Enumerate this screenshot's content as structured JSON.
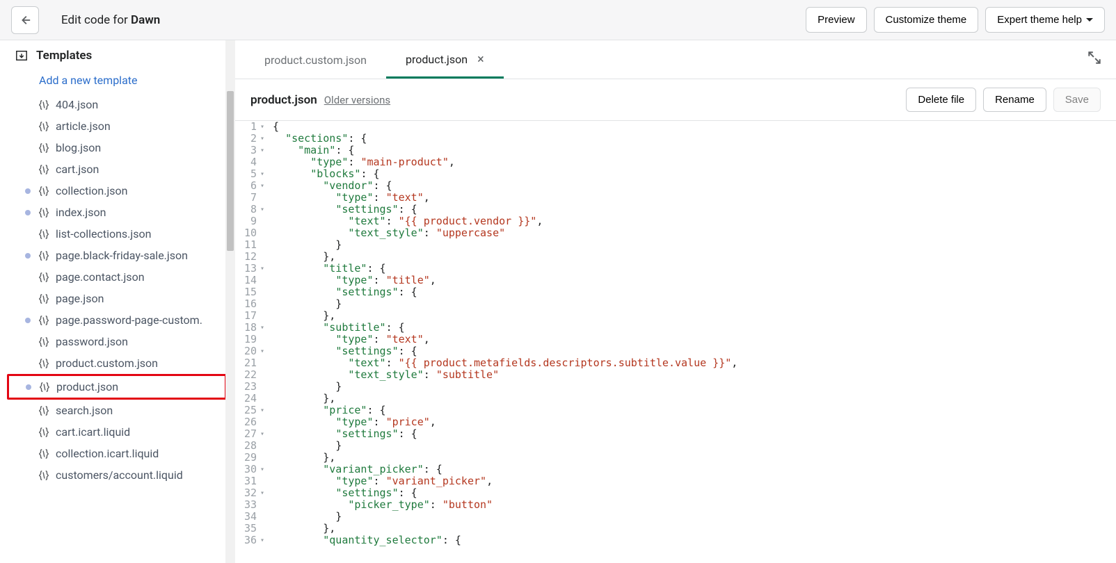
{
  "header": {
    "title_prefix": "Edit code for ",
    "title_theme": "Dawn",
    "btn_preview": "Preview",
    "btn_customize": "Customize theme",
    "btn_help": "Expert theme help"
  },
  "sidebar": {
    "section_label": "Templates",
    "add_template": "Add a new template",
    "files": [
      {
        "name": "404.json",
        "dot": false
      },
      {
        "name": "article.json",
        "dot": false
      },
      {
        "name": "blog.json",
        "dot": false
      },
      {
        "name": "cart.json",
        "dot": false
      },
      {
        "name": "collection.json",
        "dot": true
      },
      {
        "name": "index.json",
        "dot": true
      },
      {
        "name": "list-collections.json",
        "dot": false
      },
      {
        "name": "page.black-friday-sale.json",
        "dot": true
      },
      {
        "name": "page.contact.json",
        "dot": false
      },
      {
        "name": "page.json",
        "dot": false
      },
      {
        "name": "page.password-page-custom.",
        "dot": true
      },
      {
        "name": "password.json",
        "dot": false
      },
      {
        "name": "product.custom.json",
        "dot": false
      },
      {
        "name": "product.json",
        "dot": true,
        "highlight": true
      },
      {
        "name": "search.json",
        "dot": false
      },
      {
        "name": "cart.icart.liquid",
        "dot": false
      },
      {
        "name": "collection.icart.liquid",
        "dot": false
      },
      {
        "name": "customers/account.liquid",
        "dot": false
      }
    ]
  },
  "tabs": [
    {
      "label": "product.custom.json",
      "active": false,
      "close": false
    },
    {
      "label": "product.json",
      "active": true,
      "close": true
    }
  ],
  "file_toolbar": {
    "filename": "product.json",
    "older": "Older versions",
    "btn_delete": "Delete file",
    "btn_rename": "Rename",
    "btn_save": "Save"
  },
  "code": {
    "line_start": 1,
    "fold_lines": [
      1,
      2,
      3,
      5,
      6,
      8,
      13,
      18,
      20,
      25,
      27,
      30,
      32,
      36
    ],
    "lines": [
      [
        {
          "t": "{",
          "c": "plain"
        }
      ],
      [
        {
          "t": "  ",
          "c": "plain"
        },
        {
          "t": "\"sections\"",
          "c": "prop"
        },
        {
          "t": ": {",
          "c": "plain"
        }
      ],
      [
        {
          "t": "    ",
          "c": "plain"
        },
        {
          "t": "\"main\"",
          "c": "prop"
        },
        {
          "t": ": {",
          "c": "plain"
        }
      ],
      [
        {
          "t": "      ",
          "c": "plain"
        },
        {
          "t": "\"type\"",
          "c": "prop"
        },
        {
          "t": ": ",
          "c": "plain"
        },
        {
          "t": "\"main-product\"",
          "c": "str"
        },
        {
          "t": ",",
          "c": "plain"
        }
      ],
      [
        {
          "t": "      ",
          "c": "plain"
        },
        {
          "t": "\"blocks\"",
          "c": "prop"
        },
        {
          "t": ": {",
          "c": "plain"
        }
      ],
      [
        {
          "t": "        ",
          "c": "plain"
        },
        {
          "t": "\"vendor\"",
          "c": "prop"
        },
        {
          "t": ": {",
          "c": "plain"
        }
      ],
      [
        {
          "t": "          ",
          "c": "plain"
        },
        {
          "t": "\"type\"",
          "c": "prop"
        },
        {
          "t": ": ",
          "c": "plain"
        },
        {
          "t": "\"text\"",
          "c": "str"
        },
        {
          "t": ",",
          "c": "plain"
        }
      ],
      [
        {
          "t": "          ",
          "c": "plain"
        },
        {
          "t": "\"settings\"",
          "c": "prop"
        },
        {
          "t": ": {",
          "c": "plain"
        }
      ],
      [
        {
          "t": "            ",
          "c": "plain"
        },
        {
          "t": "\"text\"",
          "c": "prop"
        },
        {
          "t": ": ",
          "c": "plain"
        },
        {
          "t": "\"{{ product.vendor }}\"",
          "c": "str"
        },
        {
          "t": ",",
          "c": "plain"
        }
      ],
      [
        {
          "t": "            ",
          "c": "plain"
        },
        {
          "t": "\"text_style\"",
          "c": "prop"
        },
        {
          "t": ": ",
          "c": "plain"
        },
        {
          "t": "\"uppercase\"",
          "c": "str"
        }
      ],
      [
        {
          "t": "          }",
          "c": "plain"
        }
      ],
      [
        {
          "t": "        },",
          "c": "plain"
        }
      ],
      [
        {
          "t": "        ",
          "c": "plain"
        },
        {
          "t": "\"title\"",
          "c": "prop"
        },
        {
          "t": ": {",
          "c": "plain"
        }
      ],
      [
        {
          "t": "          ",
          "c": "plain"
        },
        {
          "t": "\"type\"",
          "c": "prop"
        },
        {
          "t": ": ",
          "c": "plain"
        },
        {
          "t": "\"title\"",
          "c": "str"
        },
        {
          "t": ",",
          "c": "plain"
        }
      ],
      [
        {
          "t": "          ",
          "c": "plain"
        },
        {
          "t": "\"settings\"",
          "c": "prop"
        },
        {
          "t": ": {",
          "c": "plain"
        }
      ],
      [
        {
          "t": "          }",
          "c": "plain"
        }
      ],
      [
        {
          "t": "        },",
          "c": "plain"
        }
      ],
      [
        {
          "t": "        ",
          "c": "plain"
        },
        {
          "t": "\"subtitle\"",
          "c": "prop"
        },
        {
          "t": ": {",
          "c": "plain"
        }
      ],
      [
        {
          "t": "          ",
          "c": "plain"
        },
        {
          "t": "\"type\"",
          "c": "prop"
        },
        {
          "t": ": ",
          "c": "plain"
        },
        {
          "t": "\"text\"",
          "c": "str"
        },
        {
          "t": ",",
          "c": "plain"
        }
      ],
      [
        {
          "t": "          ",
          "c": "plain"
        },
        {
          "t": "\"settings\"",
          "c": "prop"
        },
        {
          "t": ": {",
          "c": "plain"
        }
      ],
      [
        {
          "t": "            ",
          "c": "plain"
        },
        {
          "t": "\"text\"",
          "c": "prop"
        },
        {
          "t": ": ",
          "c": "plain"
        },
        {
          "t": "\"{{ product.metafields.descriptors.subtitle.value }}\"",
          "c": "str"
        },
        {
          "t": ",",
          "c": "plain"
        }
      ],
      [
        {
          "t": "            ",
          "c": "plain"
        },
        {
          "t": "\"text_style\"",
          "c": "prop"
        },
        {
          "t": ": ",
          "c": "plain"
        },
        {
          "t": "\"subtitle\"",
          "c": "str"
        }
      ],
      [
        {
          "t": "          }",
          "c": "plain"
        }
      ],
      [
        {
          "t": "        },",
          "c": "plain"
        }
      ],
      [
        {
          "t": "        ",
          "c": "plain"
        },
        {
          "t": "\"price\"",
          "c": "prop"
        },
        {
          "t": ": {",
          "c": "plain"
        }
      ],
      [
        {
          "t": "          ",
          "c": "plain"
        },
        {
          "t": "\"type\"",
          "c": "prop"
        },
        {
          "t": ": ",
          "c": "plain"
        },
        {
          "t": "\"price\"",
          "c": "str"
        },
        {
          "t": ",",
          "c": "plain"
        }
      ],
      [
        {
          "t": "          ",
          "c": "plain"
        },
        {
          "t": "\"settings\"",
          "c": "prop"
        },
        {
          "t": ": {",
          "c": "plain"
        }
      ],
      [
        {
          "t": "          }",
          "c": "plain"
        }
      ],
      [
        {
          "t": "        },",
          "c": "plain"
        }
      ],
      [
        {
          "t": "        ",
          "c": "plain"
        },
        {
          "t": "\"variant_picker\"",
          "c": "prop"
        },
        {
          "t": ": {",
          "c": "plain"
        }
      ],
      [
        {
          "t": "          ",
          "c": "plain"
        },
        {
          "t": "\"type\"",
          "c": "prop"
        },
        {
          "t": ": ",
          "c": "plain"
        },
        {
          "t": "\"variant_picker\"",
          "c": "str"
        },
        {
          "t": ",",
          "c": "plain"
        }
      ],
      [
        {
          "t": "          ",
          "c": "plain"
        },
        {
          "t": "\"settings\"",
          "c": "prop"
        },
        {
          "t": ": {",
          "c": "plain"
        }
      ],
      [
        {
          "t": "            ",
          "c": "plain"
        },
        {
          "t": "\"picker_type\"",
          "c": "prop"
        },
        {
          "t": ": ",
          "c": "plain"
        },
        {
          "t": "\"button\"",
          "c": "str"
        }
      ],
      [
        {
          "t": "          }",
          "c": "plain"
        }
      ],
      [
        {
          "t": "        },",
          "c": "plain"
        }
      ],
      [
        {
          "t": "        ",
          "c": "plain"
        },
        {
          "t": "\"quantity_selector\"",
          "c": "prop"
        },
        {
          "t": ": {",
          "c": "plain"
        }
      ]
    ]
  }
}
